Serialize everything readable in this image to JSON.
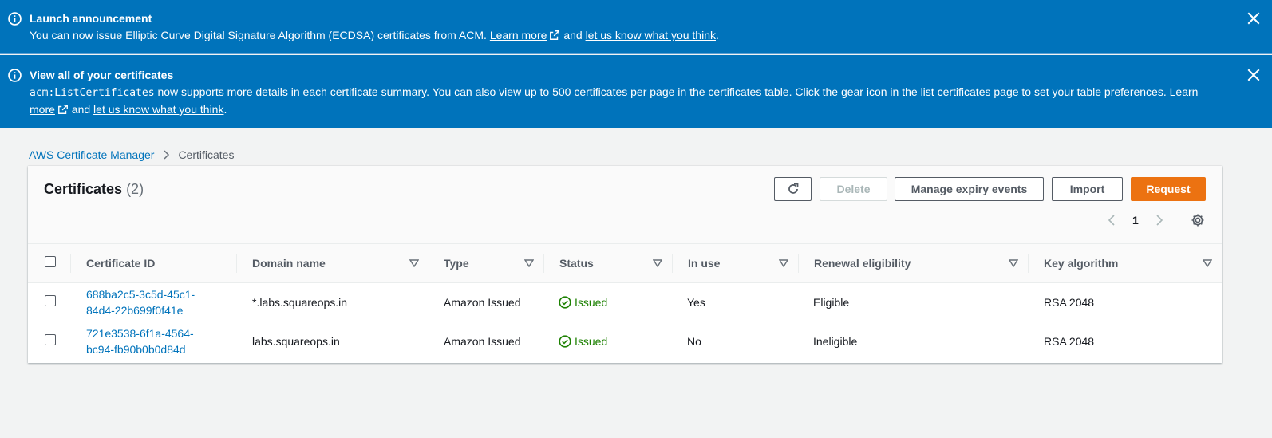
{
  "announcement1": {
    "title": "Launch announcement",
    "text": "You can now issue Elliptic Curve Digital Signature Algorithm (ECDSA) certificates from ACM.",
    "learn_more": "Learn more",
    "and": "and",
    "feedback": "let us know what you think"
  },
  "announcement2": {
    "title": "View all of your certificates",
    "code": "acm:ListCertificates",
    "text": "now supports more details in each certificate summary. You can also view up to 500 certificates per page in the certificates table. Click the gear icon in the list certificates page to set your table preferences.",
    "learn_more_1": "Learn",
    "learn_more_2": "more",
    "and": "and",
    "feedback": "let us know what you think"
  },
  "breadcrumb": {
    "root": "AWS Certificate Manager",
    "current": "Certificates"
  },
  "panel": {
    "title": "Certificates",
    "count": "(2)"
  },
  "buttons": {
    "delete": "Delete",
    "expiry": "Manage expiry events",
    "import": "Import",
    "request": "Request"
  },
  "pagination": {
    "page": "1"
  },
  "table": {
    "headers": [
      "Certificate ID",
      "Domain name",
      "Type",
      "Status",
      "In use",
      "Renewal eligibility",
      "Key algorithm"
    ],
    "rows": [
      {
        "id_line1": "688ba2c5-3c5d-45c1-",
        "id_line2": "84d4-22b699f0f41e",
        "domain": "*.labs.squareops.in",
        "type": "Amazon Issued",
        "status": "Issued",
        "in_use": "Yes",
        "renewal": "Eligible",
        "key": "RSA 2048"
      },
      {
        "id_line1": "721e3538-6f1a-4564-",
        "id_line2": "bc94-fb90b0b0d84d",
        "domain": "labs.squareops.in",
        "type": "Amazon Issued",
        "status": "Issued",
        "in_use": "No",
        "renewal": "Ineligible",
        "key": "RSA 2048"
      }
    ]
  },
  "colors": {
    "flash": "#0073bb",
    "link": "#0073bb",
    "primary": "#ec7211",
    "success": "#1d8102"
  }
}
